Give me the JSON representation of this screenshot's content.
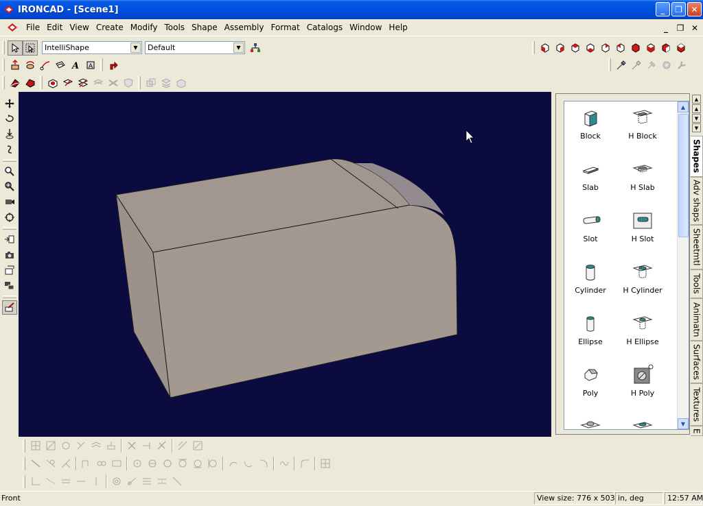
{
  "window": {
    "title": "IRONCAD - [Scene1]",
    "minimize": "_",
    "maximize": "❐",
    "close": "✕"
  },
  "menu": {
    "items": [
      "File",
      "Edit",
      "View",
      "Create",
      "Modify",
      "Tools",
      "Shape",
      "Assembly",
      "Format",
      "Catalogs",
      "Window",
      "Help"
    ]
  },
  "toolbar": {
    "selection_mode": "IntelliShape",
    "style_mode": "Default"
  },
  "catalog": {
    "items": [
      {
        "label": "Block",
        "icon": "block-icon"
      },
      {
        "label": "H Block",
        "icon": "h-block-icon"
      },
      {
        "label": "Slab",
        "icon": "slab-icon"
      },
      {
        "label": "H Slab",
        "icon": "h-slab-icon"
      },
      {
        "label": "Slot",
        "icon": "slot-icon"
      },
      {
        "label": "H Slot",
        "icon": "h-slot-icon"
      },
      {
        "label": "Cylinder",
        "icon": "cylinder-icon"
      },
      {
        "label": "H Cylinder",
        "icon": "h-cylinder-icon"
      },
      {
        "label": "Ellipse",
        "icon": "ellipse-icon"
      },
      {
        "label": "H Ellipse",
        "icon": "h-ellipse-icon"
      },
      {
        "label": "Poly",
        "icon": "poly-icon"
      },
      {
        "label": "H Poly",
        "icon": "h-poly-icon"
      }
    ]
  },
  "tabs": [
    "Shapes",
    "Adv shaps",
    "Sheetmtl",
    "Tools",
    "Animatn",
    "Surfaces",
    "Textures",
    "E"
  ],
  "status": {
    "text": "Front",
    "view_size_label": "View size:",
    "view_size": "776 x 503",
    "units": "in, deg",
    "time": "12:57 AM"
  },
  "colors": {
    "viewport_bg": "#0b0b40",
    "part_face": "#a49991",
    "titlebar": "#0050e0"
  }
}
